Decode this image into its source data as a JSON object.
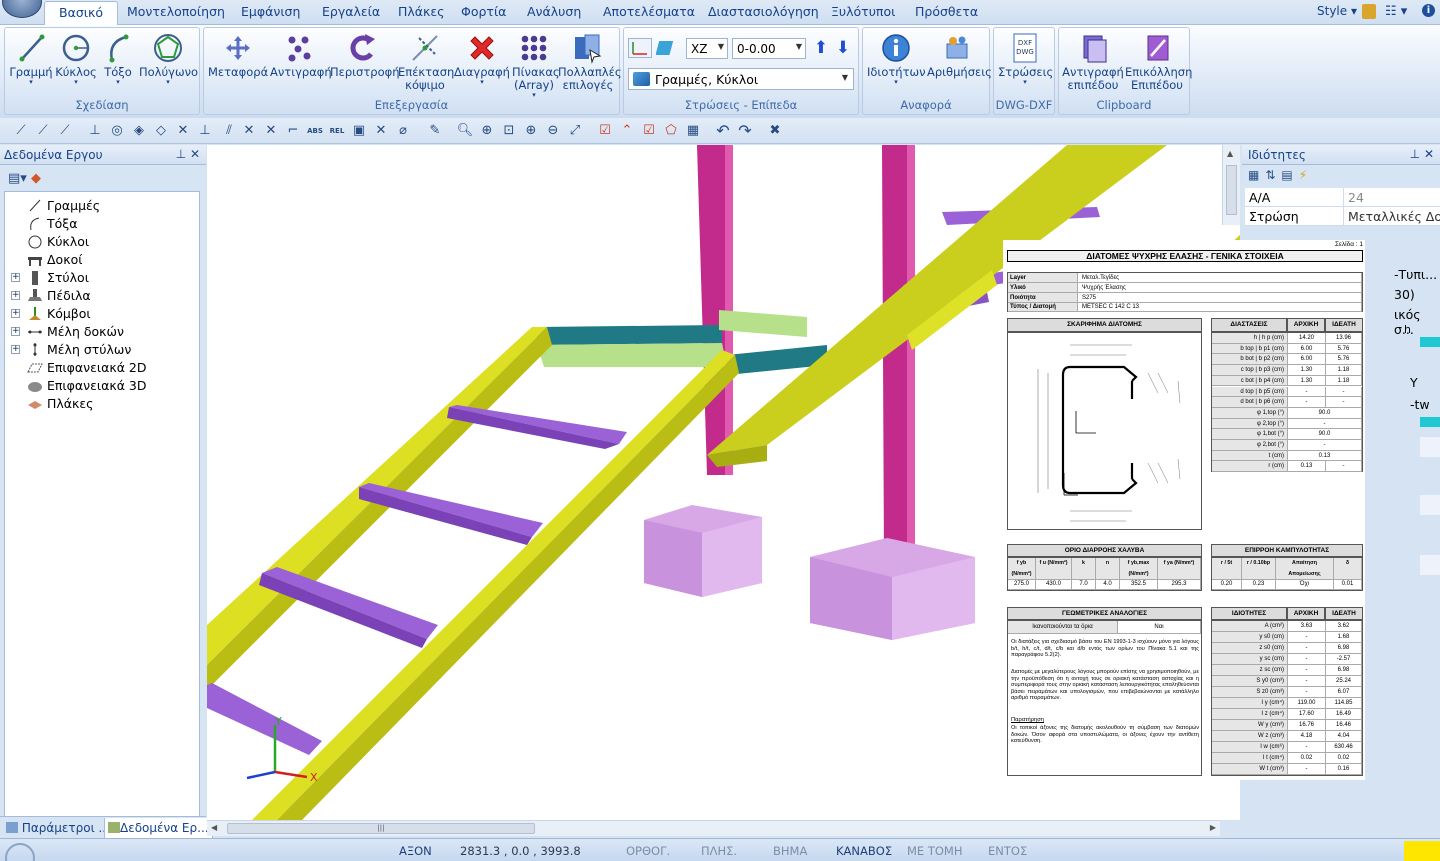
{
  "tabs": [
    "Βασικό",
    "Μοντελοποίηση",
    "Εμφάνιση",
    "Εργαλεία",
    "Πλάκες",
    "Φορτία",
    "Ανάλυση",
    "Αποτελέσματα",
    "Διαστασιολόγηση",
    "Ξυλότυποι",
    "Πρόσθετα"
  ],
  "style_label": "Style",
  "ribbon": {
    "groups": [
      {
        "label": "Σχεδίαση",
        "buttons": [
          "Γραμμή",
          "Κύκλος",
          "Τόξο",
          "Πολύγωνο"
        ]
      },
      {
        "label": "Επεξεργασία",
        "buttons": [
          "Μεταφορά",
          "Αντιγραφή",
          "Περιστροφή",
          "Επέκταση κόψιμο",
          "Διαγραφή",
          "Πίνακας (Array)",
          "Πολλαπλές επιλογές"
        ]
      },
      {
        "label": "Στρώσεις - Επίπεδα",
        "plane": "XZ",
        "offset": "0-0.00",
        "layer": "Γραμμές, Κύκλοι"
      },
      {
        "label": "Αναφορά",
        "buttons": [
          "Ιδιοτήτων",
          "Αριθμήσεις"
        ]
      },
      {
        "label": "DWG-DXF",
        "buttons": [
          "Στρώσεις"
        ]
      },
      {
        "label": "Clipboard",
        "buttons": [
          "Αντιγραφή επιπέδου",
          "Επικόλληση Επιπέδου"
        ]
      }
    ]
  },
  "left_panel": {
    "title": "Δεδομένα Εργου",
    "tree": [
      "Γραμμές",
      "Τόξα",
      "Κύκλοι",
      "Δοκοί",
      "Στύλοι",
      "Πέδιλα",
      "Κόμβοι",
      "Μέλη δοκών",
      "Μέλη στύλων",
      "Επιφανειακά 2D",
      "Επιφανειακά 3D",
      "Πλάκες"
    ],
    "bottom_tabs": [
      "Παράμετροι ...",
      "Δεδομένα Ερ..."
    ]
  },
  "right_panel": {
    "title": "Ιδιότητες",
    "rows": [
      {
        "k": "A/A",
        "v": "24"
      },
      {
        "k": "Στρώση",
        "v": "Μεταλλικές Δο..."
      }
    ],
    "cut_text": [
      "-Τυπι...",
      "30)",
      "ικός σ...",
      "h",
      "Y",
      "-tw"
    ]
  },
  "report": {
    "page": "Σελίδα : 1",
    "title": "ΔΙΑΤΟΜΕΣ ΨΥΧΡΗΣ ΕΛΑΣΗΣ - ΓΕΝΙΚΑ ΣΤΟΙΧΕΙΑ",
    "info": [
      {
        "k": "Layer",
        "v": "Μεταλ.Τεγίδες"
      },
      {
        "k": "Υλικό",
        "v": "Ψυχρής Έλασης"
      },
      {
        "k": "Ποιότητα",
        "v": "S275"
      },
      {
        "k": "Τύπος / Διατομή",
        "v": "METSEC C 142 C 13"
      }
    ],
    "sketch_title": "ΣΚΑΡΙΦΗΜΑ ΔΙΑΤΟΜΗΣ",
    "dims_headers": [
      "ΔΙΑΣΤΑΣΕΙΣ",
      "ΑΡΧΙΚΗ",
      "ΙΔΕΑΤΗ"
    ],
    "dims": [
      [
        "h | h p (cm)",
        "14.20",
        "13.96"
      ],
      [
        "b top | b p1 (cm)",
        "6.00",
        "5.76"
      ],
      [
        "b bot | b p2 (cm)",
        "6.00",
        "5.76"
      ],
      [
        "c top | b p3 (cm)",
        "1.30",
        "1.18"
      ],
      [
        "c bot | b p4 (cm)",
        "1.30",
        "1.18"
      ],
      [
        "d top | b p5 (cm)",
        "-",
        "-"
      ],
      [
        "d bot | b p6 (cm)",
        "-",
        "-"
      ],
      [
        "φ 1,top (°)",
        "90.0",
        ""
      ],
      [
        "φ 2,top (°)",
        "-",
        ""
      ],
      [
        "φ 1,bot (°)",
        "90.0",
        ""
      ],
      [
        "φ 2,bot (°)",
        "-",
        ""
      ],
      [
        "t (cm)",
        "0.13",
        ""
      ],
      [
        "r (cm)",
        "0.13",
        "-"
      ]
    ],
    "yield_title": "ΟΡΙΟ ΔΙΑΡΡΟΗΣ ΧΑΛΥΒΑ",
    "yield_headers": [
      "f yb (N/mm²)",
      "f u (N/mm²)",
      "k",
      "n",
      "f yb,max (N/mm²)",
      "f ya (N/mm²)"
    ],
    "yield_values": [
      "275.0",
      "430.0",
      "7.0",
      "4.0",
      "352.5",
      "295.3"
    ],
    "buckling_title": "ΕΠΙΡΡΟΗ ΚΑΜΠΥΛΟΤΗΤΑΣ",
    "buckling_headers": [
      "r / 5t",
      "r / 0.10bp",
      "Απαίτηση Απομείωσης",
      "δ"
    ],
    "buckling_values": [
      "0.20",
      "0.23",
      "Όχι",
      "0.01"
    ],
    "geom_title": "ΓΕΩΜΕΤΡΙΚΕΣ ΑΝΑΛΟΓΙΕΣ",
    "geom_row": [
      "Ικανοποιούνται τα όρια",
      "Ναι"
    ],
    "geom_text": [
      "Οι διατάξεις για σχεδιασμό βάσει του EN 1993-1-3 ισχύουν μόνο για λόγους b/t, h/t, c/t, d/t, c/b και d/b εντός των ορίων του Πίνακα 5.1 και της παραγράφου 5.2(2).",
      "Διατομές με μεγαλύτερους λόγους μπορούν επίσης να χρησιμοποιηθούν, με την προϋπόθεση ότι η αντοχή τους σε οριακή κατάσταση αστοχίας και η συμπεριφορά τους στην οριακή κατάσταση λειτουργικότητας επαληθεύονται βάσει πειραμάτων και υπολογισμών, που επιβεβαιώνονται με κατάλληλο αριθμό πειραμάτων.",
      "Παρατήρηση",
      "Οι τοπικοί άξονες της διατομής ακολουθούν τη σύμβαση των διατομών δοκών. Όσον αφορά στα υποστυλώματα, οι άξονες έχουν την αντίθετη κατεύθυνση."
    ],
    "props_headers": [
      "ΙΔΙΟΤΗΤΕΣ",
      "ΑΡΧΙΚΗ",
      "ΙΔΕΑΤΗ"
    ],
    "props": [
      [
        "A (cm²)",
        "3.63",
        "3.62"
      ],
      [
        "y s0 (cm)",
        "-",
        "1.68"
      ],
      [
        "z s0 (cm)",
        "-",
        "6.98"
      ],
      [
        "y sc (cm)",
        "-",
        "-2.57"
      ],
      [
        "z sc (cm)",
        "-",
        "6.98"
      ],
      [
        "S y0 (cm³)",
        "-",
        "25.24"
      ],
      [
        "S z0 (cm³)",
        "-",
        "6.07"
      ],
      [
        "I y (cm⁴)",
        "119.00",
        "114.85"
      ],
      [
        "I z (cm⁴)",
        "17.60",
        "16.49"
      ],
      [
        "W y (cm³)",
        "16.76",
        "16.46"
      ],
      [
        "W z (cm³)",
        "4.18",
        "4.04"
      ],
      [
        "I w (cm⁶)",
        "-",
        "630.46"
      ],
      [
        "I t (cm⁴)",
        "0.02",
        "0.02"
      ],
      [
        "W t (cm³)",
        "-",
        "0.16"
      ]
    ]
  },
  "axes": {
    "x": "X",
    "y": "Y"
  },
  "status": {
    "items": [
      "ΑΞΟΝ",
      "2831.3 , 0.0 , 3993.8",
      "ΟΡΘΟΓ.",
      "ΠΛΗΣ.",
      "ΒΗΜΑ",
      "ΚΑΝΑΒΟΣ",
      "ΜΕ ΤΟΜΗ",
      "ΕΝΤΟΣ"
    ]
  },
  "colors": {
    "beam": "#d2d62a",
    "column": "#cc2a8c",
    "purlin": "#9b6bd8",
    "footing": "#d9a7e3",
    "teal": "#1f7a86"
  }
}
